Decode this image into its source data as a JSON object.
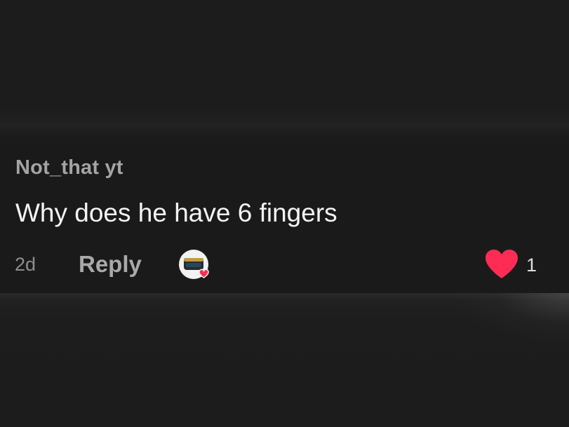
{
  "comment": {
    "username": "Not_that yt",
    "text": "Why does he have 6 fingers",
    "time": "2d",
    "reply_label": "Reply",
    "like_count": "1",
    "liked_by_creator": true,
    "liked": true
  },
  "colors": {
    "background": "#1c1c1c",
    "comment_background": "#1a1a1a",
    "username": "#a4a4a4",
    "text": "#f4f4f4",
    "heart": "#fe2c55"
  },
  "icons": {
    "like": "heart-icon",
    "creator_like": "creator-avatar-heart-badge"
  }
}
